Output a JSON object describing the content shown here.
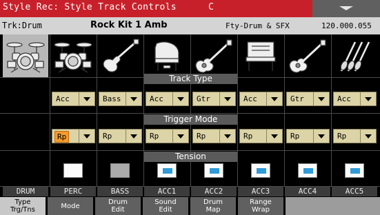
{
  "title": "Style Rec: Style Track Controls",
  "mode_indicator": "C",
  "info": {
    "track": "Trk:Drum",
    "style_name": "Rock Kit 1 Amb",
    "bank": "Fty-Drum & SFX",
    "tempo": "120.000.055"
  },
  "sections": {
    "track_type": "Track Type",
    "trigger_mode": "Trigger Mode",
    "tension": "Tension"
  },
  "colors": {
    "title_bar": "#c8202a",
    "selected_field": "#f59b2c",
    "dropdown": "#dcd4a6",
    "tension_indicator": "#2f9bd8"
  },
  "tracks": [
    {
      "label": "DRUM",
      "icon": "drum-kit-icon",
      "selected": true
    },
    {
      "label": "PERC",
      "icon": "drum-kit-icon",
      "track_type": "Acc",
      "trigger_mode": "Rp",
      "tension": "white"
    },
    {
      "label": "BASS",
      "icon": "electric-bass-icon",
      "track_type": "Bass",
      "trigger_mode": "Rp",
      "tension": "gray"
    },
    {
      "label": "ACC1",
      "icon": "grand-piano-icon",
      "track_type": "Acc",
      "trigger_mode": "Rp",
      "tension": "blue"
    },
    {
      "label": "ACC2",
      "icon": "acoustic-guitar-icon",
      "track_type": "Gtr",
      "trigger_mode": "Rp",
      "tension": "blue"
    },
    {
      "label": "ACC3",
      "icon": "upright-piano-icon",
      "track_type": "Acc",
      "trigger_mode": "Rp",
      "tension": "blue"
    },
    {
      "label": "ACC4",
      "icon": "acoustic-guitar-icon",
      "track_type": "Gtr",
      "trigger_mode": "Rp",
      "tension": "blue"
    },
    {
      "label": "ACC5",
      "icon": "strings-icon",
      "track_type": "Acc",
      "trigger_mode": "Rp",
      "tension": "blue"
    }
  ],
  "tabs": [
    {
      "line1": "Type",
      "line2": "Trg/Tns",
      "active": true
    },
    {
      "line1": "Mode",
      "line2": ""
    },
    {
      "line1": "Drum",
      "line2": "Edit"
    },
    {
      "line1": "Sound",
      "line2": "Edit"
    },
    {
      "line1": "Drum",
      "line2": "Map"
    },
    {
      "line1": "Range",
      "line2": "Wrap"
    }
  ]
}
